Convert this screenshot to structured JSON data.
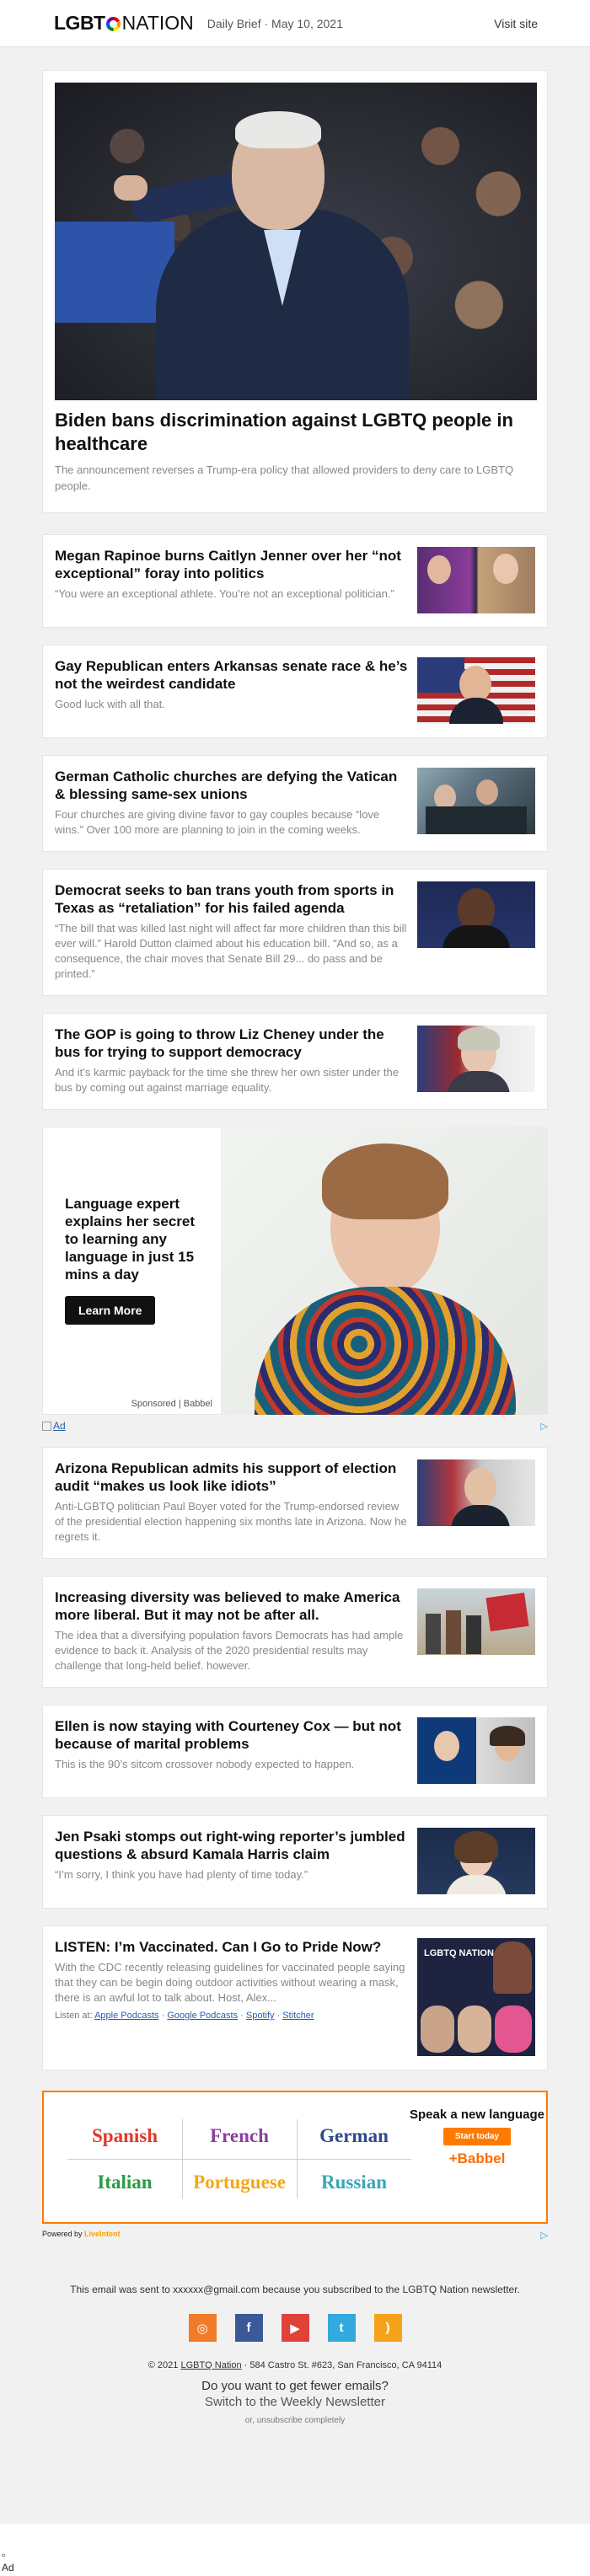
{
  "header": {
    "logo_left": "LGBT",
    "logo_right": "NATION",
    "brief": "Daily Brief · May 10, 2021",
    "visit_site": "Visit site"
  },
  "hero": {
    "title": "Biden bans discrimination against LGBTQ people in healthcare",
    "description": "The announcement reverses a Trump-era policy that allowed providers to deny care to LGBTQ people."
  },
  "stories_top": [
    {
      "title": "Megan Rapinoe burns Caitlyn Jenner over her “not exceptional” foray into politics",
      "description": "“You were an exceptional athlete. You’re not an exceptional politician.”",
      "thumb": "rapinoe-jenner-photo"
    },
    {
      "title": "Gay Republican enters Arkansas senate race & he’s not the weirdest candidate",
      "description": "Good luck with all that.",
      "thumb": "candidate-flag-photo"
    },
    {
      "title": "German Catholic churches are defying the Vatican & blessing same-sex unions",
      "description": "Four churches are giving divine favor to gay couples because “love wins.” Over 100 more are planning to join in the coming weeks.",
      "thumb": "church-blessing-photo"
    },
    {
      "title": "Democrat seeks to ban trans youth from sports in Texas as “retaliation” for his failed agenda",
      "description": "“The bill that was killed last night will affect far more children than this bill ever will.” Harold Dutton claimed about his education bill. “And so, as a consequence, the chair moves that Senate Bill 29... do pass and be printed.”",
      "thumb": "dutton-photo"
    },
    {
      "title": "The GOP is going to throw Liz Cheney under the bus for trying to support democracy",
      "description": "And it’s karmic payback for the time she threw her own sister under the bus by coming out against marriage equality.",
      "thumb": "cheney-photo"
    }
  ],
  "ad_sponsored": {
    "headline": "Language expert explains her secret to learning any language in just 15 mins a day",
    "button": "Learn More",
    "sponsor": "Sponsored | Babbel",
    "broken_alt": "Ad"
  },
  "stories_bottom": [
    {
      "title": "Arizona Republican admits his support of election audit “makes us look like idiots”",
      "description": "Anti-LGBTQ politician Paul Boyer voted for the Trump-endorsed review of the presidential election happening six months late in Arizona. Now he regrets it.",
      "thumb": "boyer-photo"
    },
    {
      "title": "Increasing diversity was believed to make America more liberal. But it may not be after all.",
      "description": "The idea that a diversifying population favors Democrats has had ample evidence to back it. Analysis of the 2020 presidential results may challenge that long-held belief. however.",
      "thumb": "polling-place-photo"
    },
    {
      "title": "Ellen is now staying with Courteney Cox — but not because of marital problems",
      "description": "This is the 90’s sitcom crossover nobody expected to happen.",
      "thumb": "ellen-cox-photo"
    },
    {
      "title": "Jen Psaki stomps out right-wing reporter’s jumbled questions & absurd Kamala Harris claim",
      "description": "“I’m sorry, I think you have had plenty of time today.”",
      "thumb": "psaki-photo"
    }
  ],
  "podcast": {
    "title": "LISTEN: I’m Vaccinated. Can I Go to Pride Now?",
    "description": "With the CDC recently releasing guidelines for vaccinated people saying that they can be begin doing outdoor activities without wearing a mask, there is an awful lot to talk about. Host, Alex...",
    "listen_at": "Listen at:",
    "links": [
      "Apple Podcasts",
      "Google Podcasts",
      "Spotify",
      "Stitcher"
    ],
    "thumb_logo": "LGBTQ NATION"
  },
  "ad_languages": {
    "languages": [
      {
        "name": "Spanish",
        "color": "#e2372c"
      },
      {
        "name": "French",
        "color": "#8a3fa0"
      },
      {
        "name": "German",
        "color": "#2e4a8c"
      },
      {
        "name": "Italian",
        "color": "#2b9a45"
      },
      {
        "name": "Portuguese",
        "color": "#f3a81a"
      },
      {
        "name": "Russian",
        "color": "#3aa6b5"
      }
    ],
    "speak": "Speak a new language",
    "start": "Start today",
    "brand": "+Babbel",
    "powered_by": "Powered by",
    "powered_brand": "LiveIntent"
  },
  "footer": {
    "sent_to": "This email was sent to xxxxxx@gmail.com because you subscribed to the LGBTQ Nation newsletter.",
    "socials": [
      {
        "name": "instagram-icon",
        "color": "#f07c2a",
        "glyph": "◎"
      },
      {
        "name": "facebook-icon",
        "color": "#3b5998",
        "glyph": "f"
      },
      {
        "name": "youtube-icon",
        "color": "#e0423a",
        "glyph": "▶"
      },
      {
        "name": "twitter-icon",
        "color": "#33aadd",
        "glyph": "t"
      },
      {
        "name": "rss-icon",
        "color": "#f7a21b",
        "glyph": ")"
      }
    ],
    "copyright_prefix": "© 2021",
    "copyright_link": "LGBTQ Nation",
    "copyright_suffix": "· 584 Castro St. #623, San Francisco, CA 94114",
    "fewer_q": "Do you want to get fewer emails?",
    "weekly": "Switch to the Weekly Newsletter",
    "unsub": "or, unsubscribe completely",
    "bottom_alt": "Ad"
  },
  "adchoices": "▷"
}
